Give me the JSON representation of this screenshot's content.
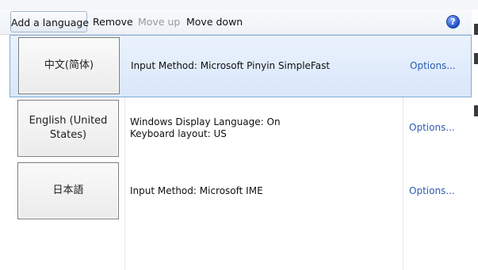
{
  "toolbar": {
    "add_language_label": "Add a language",
    "remove_label": "Remove",
    "move_up_label": "Move up",
    "move_down_label": "Move down",
    "help_glyph": "?",
    "help_icon": "help-icon"
  },
  "languages": [
    {
      "name": "中文(简体)",
      "details": [
        "Input Method: Microsoft Pinyin SimpleFast"
      ],
      "options_label": "Options...",
      "selected": true
    },
    {
      "name": "English (United States)",
      "details": [
        "Windows Display Language: On",
        "Keyboard layout: US"
      ],
      "options_label": "Options...",
      "selected": false
    },
    {
      "name": "日本語",
      "details": [
        "Input Method: Microsoft IME"
      ],
      "options_label": "Options...",
      "selected": false
    }
  ],
  "colors": {
    "link": "#2a5db0",
    "selection": "#d9e7fa",
    "disabled_text": "#9a9a9a"
  }
}
